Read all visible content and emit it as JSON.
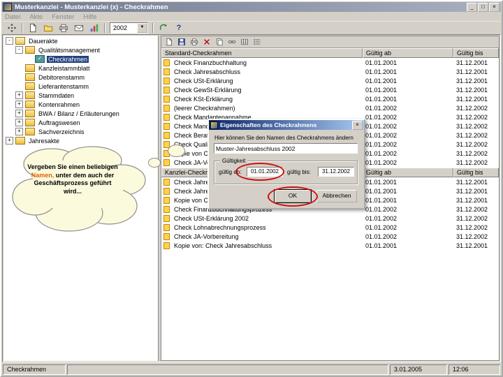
{
  "window": {
    "title": "Musterkanzlei - Musterkanzlei (x) - Checkrahmen",
    "controls": {
      "minimize": "_",
      "maximize": "□",
      "close": "×"
    }
  },
  "menubar": {
    "items": [
      "Datei",
      "Akte",
      "Fenster",
      "Hilfe"
    ]
  },
  "toolbar": {
    "year": "2002",
    "dropdown_arrow": "▼",
    "help_glyph": "?"
  },
  "icons": {
    "titlebar": [
      "application-icon",
      "minimize-icon",
      "maximize-icon",
      "close-icon"
    ],
    "main_toolbar": [
      "pan-icon",
      "new-document-icon",
      "open-folder-icon",
      "print-icon",
      "mail-icon",
      "chart-icon",
      "refresh-icon",
      "help-icon"
    ],
    "panel_toolbar": [
      "new-document-icon",
      "save-icon",
      "print-icon",
      "delete-icon",
      "copy-icon",
      "link-icon",
      "grid-view-icon",
      "list-view-icon"
    ],
    "dialog": [
      "dialog-icon",
      "close-icon"
    ],
    "list_row_bullet": "note-icon",
    "tree_icons": [
      "folder-icon",
      "check-icon"
    ]
  },
  "tree": {
    "items": [
      {
        "label": "Dauerakte",
        "level": 0,
        "expander": "-",
        "icon": "folder-open"
      },
      {
        "label": "Qualitätsmanagement",
        "level": 1,
        "expander": "-",
        "icon": "folder"
      },
      {
        "label": "Checkrahmen",
        "level": 2,
        "expander": "",
        "icon": "check",
        "selected": true
      },
      {
        "label": "Kanzleistammblatt",
        "level": 1,
        "expander": "",
        "icon": "folder"
      },
      {
        "label": "Debitorenstamm",
        "level": 1,
        "expander": "",
        "icon": "folder"
      },
      {
        "label": "Lieferantenstamm",
        "level": 1,
        "expander": "",
        "icon": "folder"
      },
      {
        "label": "Stammdaten",
        "level": 1,
        "expander": "+",
        "icon": "folder"
      },
      {
        "label": "Kontenrahmen",
        "level": 1,
        "expander": "+",
        "icon": "folder"
      },
      {
        "label": "BWA / Bilanz / Erläuterungen",
        "level": 1,
        "expander": "+",
        "icon": "folder"
      },
      {
        "label": "Auftragswesen",
        "level": 1,
        "expander": "+",
        "icon": "folder"
      },
      {
        "label": "Sachverzeichnis",
        "level": 1,
        "expander": "+",
        "icon": "folder"
      },
      {
        "label": "Jahresakte",
        "level": 0,
        "expander": "+",
        "icon": "folder"
      }
    ]
  },
  "right_panel": {
    "table1": {
      "headers": [
        "Standard-Checkrahmen",
        "Gültig ab",
        "Gültig bis"
      ],
      "rows": [
        {
          "name": "Check Finanzbuchhaltung",
          "ab": "01.01.2001",
          "bis": "31.12.2001"
        },
        {
          "name": "Check Jahresabschluss",
          "ab": "01.01.2001",
          "bis": "31.12.2001"
        },
        {
          "name": "Check USt-Erklärung",
          "ab": "01.01.2001",
          "bis": "31.12.2001"
        },
        {
          "name": "Check GewSt-Erklärung",
          "ab": "01.01.2001",
          "bis": "31.12.2001"
        },
        {
          "name": "Check KSt-Erklärung",
          "ab": "01.01.2001",
          "bis": "31.12.2001"
        },
        {
          "name": "(leerer Checkrahmen)",
          "ab": "01.01.2002",
          "bis": "31.12.2002"
        },
        {
          "name": "Check Mandantenannahme",
          "ab": "01.01.2002",
          "bis": "31.12.2002"
        },
        {
          "name": "Check Mandatsbeendigung",
          "ab": "01.01.2002",
          "bis": "31.12.2002"
        },
        {
          "name": "Check Beratung",
          "ab": "01.01.2002",
          "bis": "31.12.2002"
        },
        {
          "name": "Check Qualitätssicherung",
          "ab": "01.01.2002",
          "bis": "31.12.2002"
        },
        {
          "name": "Kopie von Check Jahresabschluss",
          "ab": "01.01.2002",
          "bis": "31.12.2002"
        },
        {
          "name": "Check JA-Vorbereitung",
          "ab": "01.01.2002",
          "bis": "31.12.2002"
        }
      ]
    },
    "table2": {
      "headers": [
        "Kanzlei-Checkrahmen",
        "Gültig ab",
        "Gültig bis"
      ],
      "rows": [
        {
          "name": "Check Jahresabschluss 2001",
          "ab": "01.01.2001",
          "bis": "31.12.2001"
        },
        {
          "name": "Check Jahresplanung",
          "ab": "01.01.2001",
          "bis": "31.12.2001"
        },
        {
          "name": "Kopie von Check Finanzbuchhaltung",
          "ab": "01.01.2001",
          "bis": "31.12.2001"
        },
        {
          "name": "Check Finanzbuchhaltungsprozess",
          "ab": "01.01.2002",
          "bis": "31.12.2002"
        },
        {
          "name": "Check USt-Erklärung 2002",
          "ab": "01.01.2002",
          "bis": "31.12.2002"
        },
        {
          "name": "Check Lohnabrechnungsprozess",
          "ab": "01.01.2002",
          "bis": "31.12.2002"
        },
        {
          "name": "Check JA-Vorbereitung",
          "ab": "01.01.2002",
          "bis": "31.12.2002"
        },
        {
          "name": "Kopie von: Check Jahresabschluss",
          "ab": "01.01.2001",
          "bis": "31.12.2001"
        }
      ]
    }
  },
  "dialog": {
    "title": "Eigenschaften des Checkrahmens",
    "close_glyph": "×",
    "label": "Hier können Sie den Namen des Checkrahmens ändern",
    "input_value": "Muster-Jahresabschluss 2002",
    "groupbox": "Gültigkeit",
    "ab_label": "gültig ab:",
    "ab_value": "01.01.2002",
    "bis_label": "gültig bis:",
    "bis_value": "31.12.2002",
    "ok": "OK",
    "cancel": "Abbrechen"
  },
  "callout": {
    "text_before": "Vergeben Sie einen beliebigen ",
    "highlight": "Namen,",
    "text_after": " unter dem auch der Geschäftsprozess geführt wird...",
    "highlight_color": "#e06200"
  },
  "statusbar": {
    "left": "Checkrahmen",
    "date": "3.01.2005",
    "time": "12:06"
  }
}
